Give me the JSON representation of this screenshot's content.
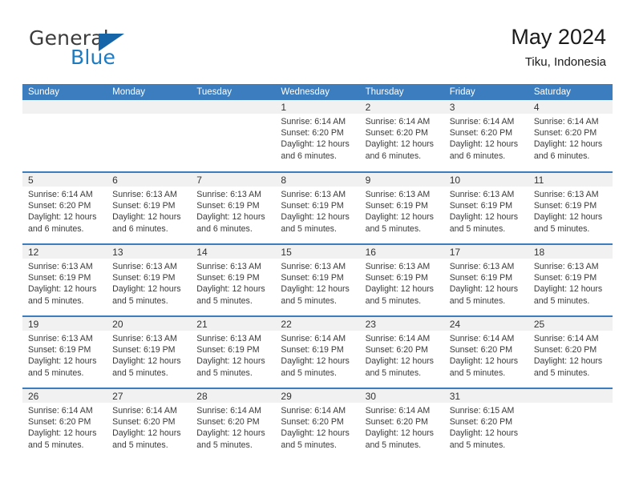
{
  "brand": {
    "name_top": "General",
    "name_bottom": "Blue",
    "triangle_color": "#1665a8",
    "blue_text_color": "#1f7bc1",
    "gray_text_color": "#3c3c3c"
  },
  "header": {
    "title": "May 2024",
    "subtitle": "Tiku, Indonesia"
  },
  "colors": {
    "header_blue": "#3b7dbe",
    "day_band_gray": "#f1f1f1",
    "row_divider_blue": "#3b7dbe"
  },
  "weekday_headers": [
    "Sunday",
    "Monday",
    "Tuesday",
    "Wednesday",
    "Thursday",
    "Friday",
    "Saturday"
  ],
  "weeks": [
    [
      {
        "day": "",
        "empty": true
      },
      {
        "day": "",
        "empty": true
      },
      {
        "day": "",
        "empty": true
      },
      {
        "day": "1",
        "sunrise": "Sunrise: 6:14 AM",
        "sunset": "Sunset: 6:20 PM",
        "daylight_line1": "Daylight: 12 hours",
        "daylight_line2": "and 6 minutes."
      },
      {
        "day": "2",
        "sunrise": "Sunrise: 6:14 AM",
        "sunset": "Sunset: 6:20 PM",
        "daylight_line1": "Daylight: 12 hours",
        "daylight_line2": "and 6 minutes."
      },
      {
        "day": "3",
        "sunrise": "Sunrise: 6:14 AM",
        "sunset": "Sunset: 6:20 PM",
        "daylight_line1": "Daylight: 12 hours",
        "daylight_line2": "and 6 minutes."
      },
      {
        "day": "4",
        "sunrise": "Sunrise: 6:14 AM",
        "sunset": "Sunset: 6:20 PM",
        "daylight_line1": "Daylight: 12 hours",
        "daylight_line2": "and 6 minutes."
      }
    ],
    [
      {
        "day": "5",
        "sunrise": "Sunrise: 6:14 AM",
        "sunset": "Sunset: 6:20 PM",
        "daylight_line1": "Daylight: 12 hours",
        "daylight_line2": "and 6 minutes."
      },
      {
        "day": "6",
        "sunrise": "Sunrise: 6:13 AM",
        "sunset": "Sunset: 6:19 PM",
        "daylight_line1": "Daylight: 12 hours",
        "daylight_line2": "and 6 minutes."
      },
      {
        "day": "7",
        "sunrise": "Sunrise: 6:13 AM",
        "sunset": "Sunset: 6:19 PM",
        "daylight_line1": "Daylight: 12 hours",
        "daylight_line2": "and 6 minutes."
      },
      {
        "day": "8",
        "sunrise": "Sunrise: 6:13 AM",
        "sunset": "Sunset: 6:19 PM",
        "daylight_line1": "Daylight: 12 hours",
        "daylight_line2": "and 5 minutes."
      },
      {
        "day": "9",
        "sunrise": "Sunrise: 6:13 AM",
        "sunset": "Sunset: 6:19 PM",
        "daylight_line1": "Daylight: 12 hours",
        "daylight_line2": "and 5 minutes."
      },
      {
        "day": "10",
        "sunrise": "Sunrise: 6:13 AM",
        "sunset": "Sunset: 6:19 PM",
        "daylight_line1": "Daylight: 12 hours",
        "daylight_line2": "and 5 minutes."
      },
      {
        "day": "11",
        "sunrise": "Sunrise: 6:13 AM",
        "sunset": "Sunset: 6:19 PM",
        "daylight_line1": "Daylight: 12 hours",
        "daylight_line2": "and 5 minutes."
      }
    ],
    [
      {
        "day": "12",
        "sunrise": "Sunrise: 6:13 AM",
        "sunset": "Sunset: 6:19 PM",
        "daylight_line1": "Daylight: 12 hours",
        "daylight_line2": "and 5 minutes."
      },
      {
        "day": "13",
        "sunrise": "Sunrise: 6:13 AM",
        "sunset": "Sunset: 6:19 PM",
        "daylight_line1": "Daylight: 12 hours",
        "daylight_line2": "and 5 minutes."
      },
      {
        "day": "14",
        "sunrise": "Sunrise: 6:13 AM",
        "sunset": "Sunset: 6:19 PM",
        "daylight_line1": "Daylight: 12 hours",
        "daylight_line2": "and 5 minutes."
      },
      {
        "day": "15",
        "sunrise": "Sunrise: 6:13 AM",
        "sunset": "Sunset: 6:19 PM",
        "daylight_line1": "Daylight: 12 hours",
        "daylight_line2": "and 5 minutes."
      },
      {
        "day": "16",
        "sunrise": "Sunrise: 6:13 AM",
        "sunset": "Sunset: 6:19 PM",
        "daylight_line1": "Daylight: 12 hours",
        "daylight_line2": "and 5 minutes."
      },
      {
        "day": "17",
        "sunrise": "Sunrise: 6:13 AM",
        "sunset": "Sunset: 6:19 PM",
        "daylight_line1": "Daylight: 12 hours",
        "daylight_line2": "and 5 minutes."
      },
      {
        "day": "18",
        "sunrise": "Sunrise: 6:13 AM",
        "sunset": "Sunset: 6:19 PM",
        "daylight_line1": "Daylight: 12 hours",
        "daylight_line2": "and 5 minutes."
      }
    ],
    [
      {
        "day": "19",
        "sunrise": "Sunrise: 6:13 AM",
        "sunset": "Sunset: 6:19 PM",
        "daylight_line1": "Daylight: 12 hours",
        "daylight_line2": "and 5 minutes."
      },
      {
        "day": "20",
        "sunrise": "Sunrise: 6:13 AM",
        "sunset": "Sunset: 6:19 PM",
        "daylight_line1": "Daylight: 12 hours",
        "daylight_line2": "and 5 minutes."
      },
      {
        "day": "21",
        "sunrise": "Sunrise: 6:13 AM",
        "sunset": "Sunset: 6:19 PM",
        "daylight_line1": "Daylight: 12 hours",
        "daylight_line2": "and 5 minutes."
      },
      {
        "day": "22",
        "sunrise": "Sunrise: 6:14 AM",
        "sunset": "Sunset: 6:19 PM",
        "daylight_line1": "Daylight: 12 hours",
        "daylight_line2": "and 5 minutes."
      },
      {
        "day": "23",
        "sunrise": "Sunrise: 6:14 AM",
        "sunset": "Sunset: 6:20 PM",
        "daylight_line1": "Daylight: 12 hours",
        "daylight_line2": "and 5 minutes."
      },
      {
        "day": "24",
        "sunrise": "Sunrise: 6:14 AM",
        "sunset": "Sunset: 6:20 PM",
        "daylight_line1": "Daylight: 12 hours",
        "daylight_line2": "and 5 minutes."
      },
      {
        "day": "25",
        "sunrise": "Sunrise: 6:14 AM",
        "sunset": "Sunset: 6:20 PM",
        "daylight_line1": "Daylight: 12 hours",
        "daylight_line2": "and 5 minutes."
      }
    ],
    [
      {
        "day": "26",
        "sunrise": "Sunrise: 6:14 AM",
        "sunset": "Sunset: 6:20 PM",
        "daylight_line1": "Daylight: 12 hours",
        "daylight_line2": "and 5 minutes."
      },
      {
        "day": "27",
        "sunrise": "Sunrise: 6:14 AM",
        "sunset": "Sunset: 6:20 PM",
        "daylight_line1": "Daylight: 12 hours",
        "daylight_line2": "and 5 minutes."
      },
      {
        "day": "28",
        "sunrise": "Sunrise: 6:14 AM",
        "sunset": "Sunset: 6:20 PM",
        "daylight_line1": "Daylight: 12 hours",
        "daylight_line2": "and 5 minutes."
      },
      {
        "day": "29",
        "sunrise": "Sunrise: 6:14 AM",
        "sunset": "Sunset: 6:20 PM",
        "daylight_line1": "Daylight: 12 hours",
        "daylight_line2": "and 5 minutes."
      },
      {
        "day": "30",
        "sunrise": "Sunrise: 6:14 AM",
        "sunset": "Sunset: 6:20 PM",
        "daylight_line1": "Daylight: 12 hours",
        "daylight_line2": "and 5 minutes."
      },
      {
        "day": "31",
        "sunrise": "Sunrise: 6:15 AM",
        "sunset": "Sunset: 6:20 PM",
        "daylight_line1": "Daylight: 12 hours",
        "daylight_line2": "and 5 minutes."
      },
      {
        "day": "",
        "empty": true
      }
    ]
  ]
}
